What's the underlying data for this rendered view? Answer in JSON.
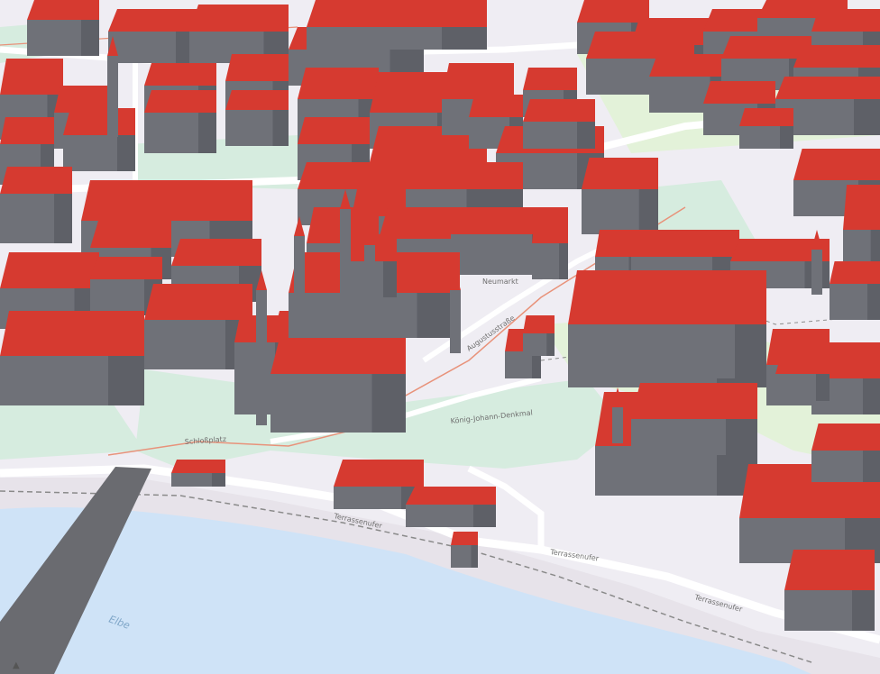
{
  "map": {
    "colors": {
      "background": "#efedf3",
      "green": "#d6ecdf",
      "park": "#e3f2d9",
      "water": "#cfe3f7",
      "river_bank": "#e7e3ea",
      "roof": "#d63a30",
      "wall": "#6f7178",
      "wall_dark": "#5e6067",
      "road": "#ffffff",
      "tram": "#e8927a",
      "path": "#8a8a8a"
    },
    "labels": {
      "river": "Elbe",
      "terrace_lower": "Terrassenufer",
      "terrace_right": "Terrassenufer",
      "terrace_far": "Terrassenufer",
      "schlossplatz": "Schloßplatz",
      "denkmal": "König-Johann-Denkmal",
      "augustus": "Augustusstraße",
      "neumarkt": "Neumarkt"
    },
    "compass_glyph": "▲"
  }
}
